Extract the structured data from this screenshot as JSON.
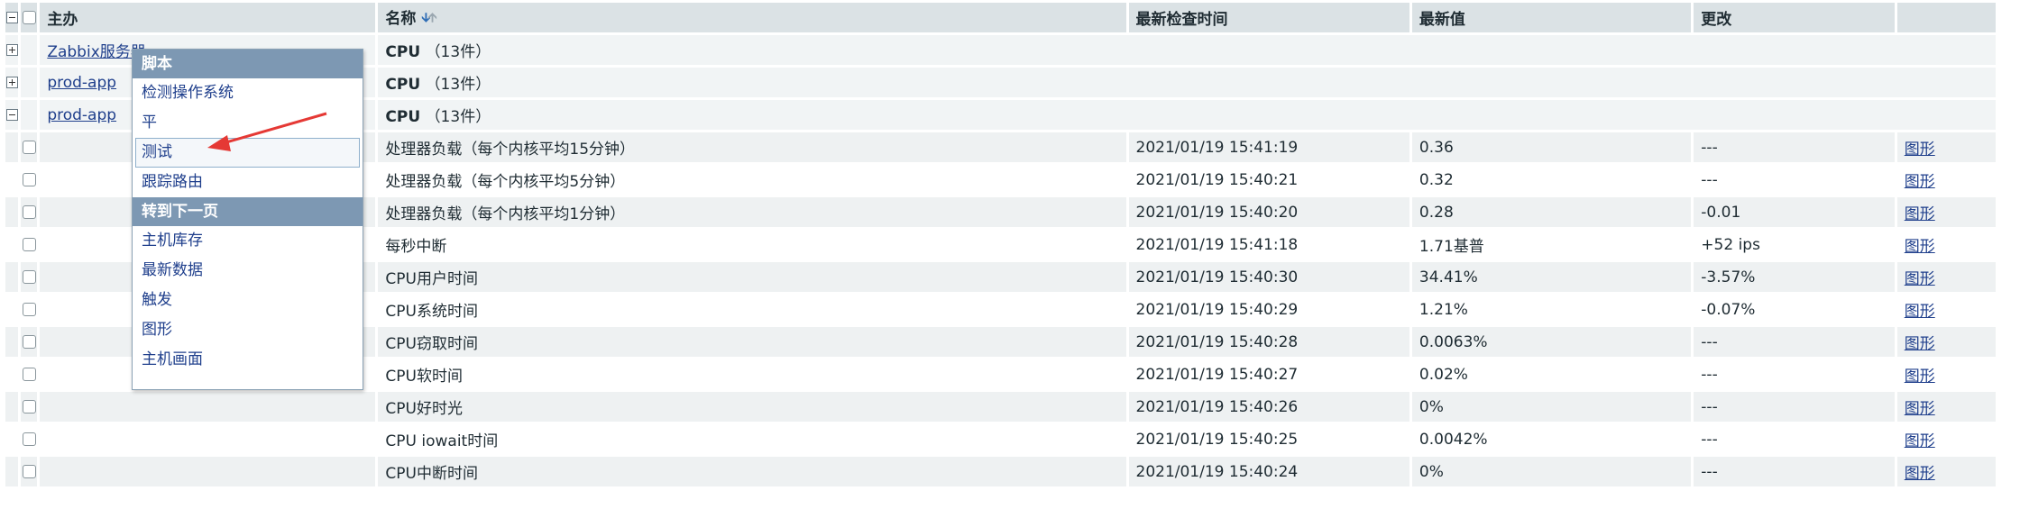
{
  "table": {
    "headers": {
      "host": "主办",
      "name": "名称",
      "last_check": "最新检查时间",
      "last_value": "最新值",
      "change": "更改"
    },
    "groups": [
      {
        "host": "Zabbix服务器",
        "name": "CPU",
        "count": "（13件）",
        "expanded": false
      },
      {
        "host": "prod-app",
        "name": "CPU",
        "count": "（13件）",
        "expanded": false
      },
      {
        "host": "prod-app",
        "name": "CPU",
        "count": "（13件）",
        "expanded": true
      }
    ],
    "rows": [
      {
        "name": "处理器负载（每个内核平均15分钟）",
        "time": "2021/01/19 15:41:19",
        "value": "0.36",
        "change": "---",
        "link": "图形"
      },
      {
        "name": "处理器负载（每个内核平均5分钟）",
        "time": "2021/01/19 15:40:21",
        "value": "0.32",
        "change": "---",
        "link": "图形"
      },
      {
        "name": "处理器负载（每个内核平均1分钟）",
        "time": "2021/01/19 15:40:20",
        "value": "0.28",
        "change": "-0.01",
        "link": "图形"
      },
      {
        "name": "每秒中断",
        "time": "2021/01/19 15:41:18",
        "value": "1.71基普",
        "change": "+52 ips",
        "link": "图形"
      },
      {
        "name": "CPU用户时间",
        "time": "2021/01/19 15:40:30",
        "value": "34.41%",
        "change": "-3.57%",
        "link": "图形"
      },
      {
        "name": "CPU系统时间",
        "time": "2021/01/19 15:40:29",
        "value": "1.21%",
        "change": "-0.07%",
        "link": "图形"
      },
      {
        "name": "CPU窃取时间",
        "time": "2021/01/19 15:40:28",
        "value": "0.0063%",
        "change": "---",
        "link": "图形"
      },
      {
        "name": "CPU软时间",
        "time": "2021/01/19 15:40:27",
        "value": "0.02%",
        "change": "---",
        "link": "图形"
      },
      {
        "name": "CPU好时光",
        "time": "2021/01/19 15:40:26",
        "value": "0%",
        "change": "---",
        "link": "图形"
      },
      {
        "name": "CPU iowait时间",
        "time": "2021/01/19 15:40:25",
        "value": "0.0042%",
        "change": "---",
        "link": "图形"
      },
      {
        "name": "CPU中断时间",
        "time": "2021/01/19 15:40:24",
        "value": "0%",
        "change": "---",
        "link": "图形"
      }
    ]
  },
  "context_menu": {
    "section1_title": "脚本",
    "section1_items": [
      "检测操作系统",
      "平",
      "测试",
      "跟踪路由"
    ],
    "selected_item": "测试",
    "section2_title": "转到下一页",
    "section2_items": [
      "主机库存",
      "最新数据",
      "触发",
      "图形",
      "主机画面"
    ]
  },
  "colors": {
    "header_bg": "#dbe2e5",
    "menu_header_bg": "#7d98b3",
    "link": "#1f3f8c",
    "annotation_arrow": "#e53935"
  },
  "icons": {
    "sort": "sort-desc-icon",
    "collapse": "minus-box-icon",
    "expand": "plus-box-icon"
  }
}
